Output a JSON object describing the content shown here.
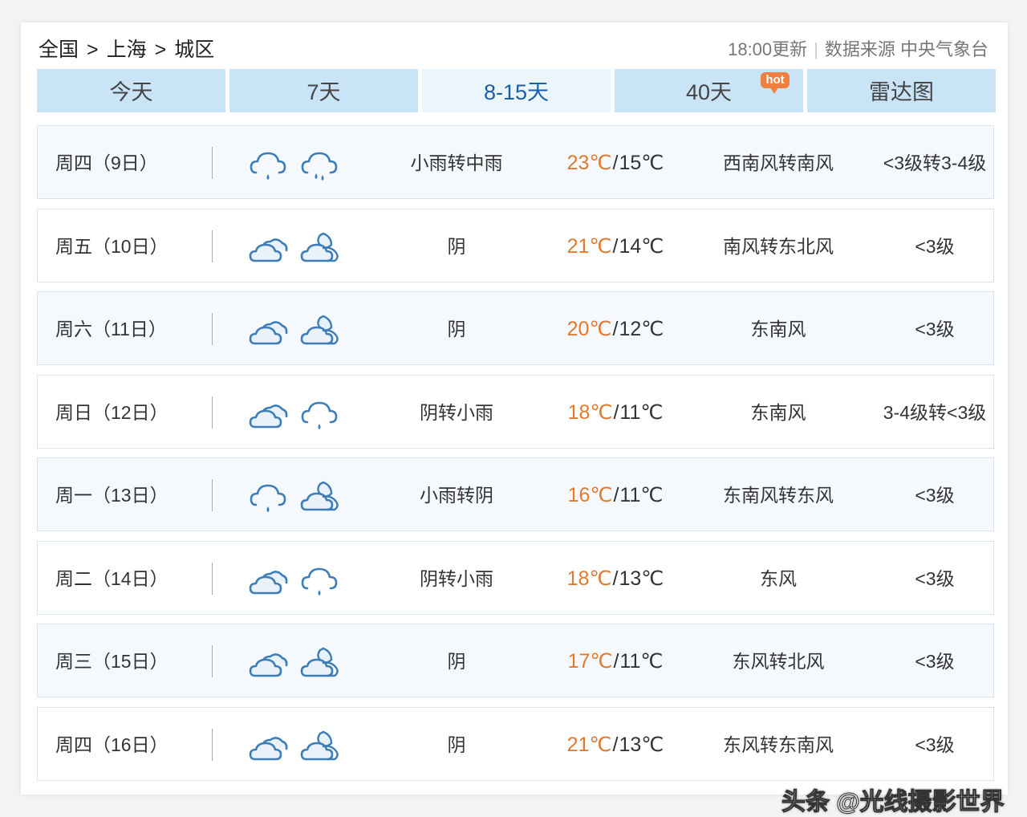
{
  "breadcrumb": [
    "全国",
    "上海",
    "城区"
  ],
  "breadcrumb_sep": ">",
  "source": {
    "update": "18:00更新",
    "divider": "|",
    "label": "数据来源 中央气象台"
  },
  "tabs": [
    {
      "label": "今天",
      "active": false
    },
    {
      "label": "7天",
      "active": false
    },
    {
      "label": "8-15天",
      "active": true
    },
    {
      "label": "40天",
      "active": false,
      "badge": "hot"
    },
    {
      "label": "雷达图",
      "active": false
    }
  ],
  "colors": {
    "high_temp": "#e07a2e",
    "active_tab_text": "#1b5fa8",
    "tab_bg": "#c9e3f7",
    "icon_stroke": "#3d7db8"
  },
  "forecast": [
    {
      "date": "周四（9日）",
      "icons": [
        "light-rain-icon",
        "moderate-rain-icon"
      ],
      "weather": "小雨转中雨",
      "high": "23℃",
      "low": "15℃",
      "wind": "西南风转南风",
      "level": "<3级转3-4级"
    },
    {
      "date": "周五（10日）",
      "icons": [
        "overcast-icon",
        "partly-cloudy-night-icon"
      ],
      "weather": "阴",
      "high": "21℃",
      "low": "14℃",
      "wind": "南风转东北风",
      "level": "<3级"
    },
    {
      "date": "周六（11日）",
      "icons": [
        "overcast-icon",
        "partly-cloudy-night-icon"
      ],
      "weather": "阴",
      "high": "20℃",
      "low": "12℃",
      "wind": "东南风",
      "level": "<3级"
    },
    {
      "date": "周日（12日）",
      "icons": [
        "overcast-icon",
        "light-rain-icon"
      ],
      "weather": "阴转小雨",
      "high": "18℃",
      "low": "11℃",
      "wind": "东南风",
      "level": "3-4级转<3级"
    },
    {
      "date": "周一（13日）",
      "icons": [
        "light-rain-icon",
        "partly-cloudy-night-icon"
      ],
      "weather": "小雨转阴",
      "high": "16℃",
      "low": "11℃",
      "wind": "东南风转东风",
      "level": "<3级"
    },
    {
      "date": "周二（14日）",
      "icons": [
        "overcast-icon",
        "light-rain-icon"
      ],
      "weather": "阴转小雨",
      "high": "18℃",
      "low": "13℃",
      "wind": "东风",
      "level": "<3级"
    },
    {
      "date": "周三（15日）",
      "icons": [
        "overcast-icon",
        "partly-cloudy-night-icon"
      ],
      "weather": "阴",
      "high": "17℃",
      "low": "11℃",
      "wind": "东风转北风",
      "level": "<3级"
    },
    {
      "date": "周四（16日）",
      "icons": [
        "overcast-icon",
        "partly-cloudy-night-icon"
      ],
      "weather": "阴",
      "high": "21℃",
      "low": "13℃",
      "wind": "东风转东南风",
      "level": "<3级"
    }
  ],
  "watermark": "头条 @光线摄影世界"
}
